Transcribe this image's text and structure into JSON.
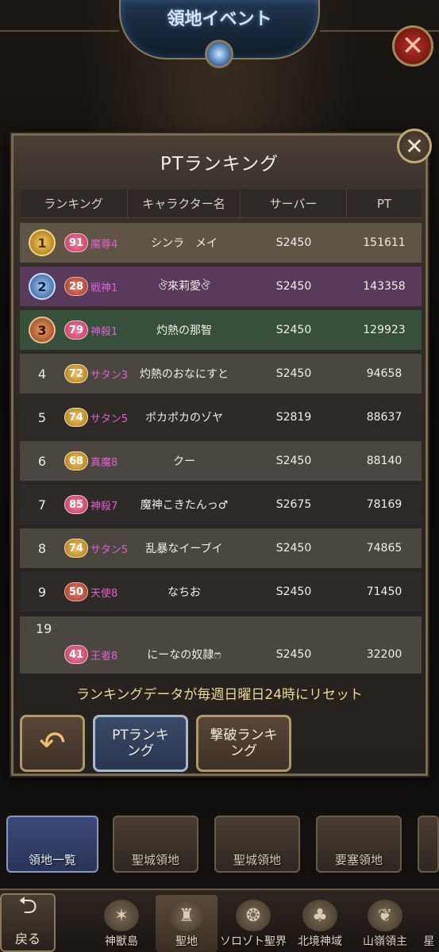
{
  "header": {
    "event_title": "領地イベント"
  },
  "dialog": {
    "title": "PTランキング",
    "columns": [
      "ランキング",
      "キャラクター名",
      "サーバー",
      "PT"
    ],
    "rows": [
      {
        "rank": "1",
        "level": "91",
        "title": "魔尊4",
        "name": "シンラ　メイ",
        "server": "S2450",
        "pt": "151611"
      },
      {
        "rank": "2",
        "level": "28",
        "title": "戦神1",
        "name": "ঔ來莉愛ঔ",
        "server": "S2450",
        "pt": "143358"
      },
      {
        "rank": "3",
        "level": "79",
        "title": "神殺1",
        "name": "灼熱の那智",
        "server": "S2450",
        "pt": "129923"
      },
      {
        "rank": "4",
        "level": "72",
        "title": "サタン3",
        "name": "灼熱のおなにすと",
        "server": "S2450",
        "pt": "94658"
      },
      {
        "rank": "5",
        "level": "74",
        "title": "サタン5",
        "name": "ポカポカのゾヤ",
        "server": "S2819",
        "pt": "88637"
      },
      {
        "rank": "6",
        "level": "68",
        "title": "真魔8",
        "name": "クー",
        "server": "S2450",
        "pt": "88140"
      },
      {
        "rank": "7",
        "level": "85",
        "title": "神殺7",
        "name": "魔神こきたんっ♂",
        "server": "S2675",
        "pt": "78169"
      },
      {
        "rank": "8",
        "level": "74",
        "title": "サタン5",
        "name": "乱暴なイーブイ",
        "server": "S2450",
        "pt": "74865"
      },
      {
        "rank": "9",
        "level": "50",
        "title": "天使8",
        "name": "なちお",
        "server": "S2450",
        "pt": "71450"
      }
    ],
    "self_row": {
      "rank": "19",
      "level": "41",
      "title": "王者8",
      "name": "にーなの奴隷ෆ",
      "server": "S2450",
      "pt": "32200"
    },
    "reset_note": "ランキングデータが毎週日曜日24時にリセット",
    "buttons": {
      "pt_ranking": "PTランキ\nング",
      "kill_ranking": "撃破ランキ\nング"
    }
  },
  "territory_tabs": [
    "領地一覧",
    "聖城領地",
    "聖城領地",
    "要塞領地"
  ],
  "bottom_nav": {
    "back": "戻る",
    "items": [
      "神獣島",
      "聖地",
      "ソロゾト聖界",
      "北境神域",
      "山嶺領主",
      "星"
    ]
  }
}
